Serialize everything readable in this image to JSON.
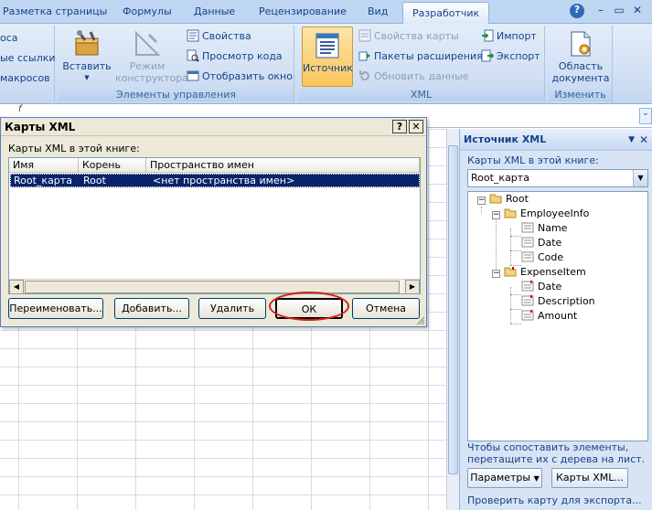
{
  "tabs": [
    "Разметка страницы",
    "Формулы",
    "Данные",
    "Рецензирование",
    "Вид",
    "Разработчик"
  ],
  "active_tab": "Разработчик",
  "window_controls": [
    "?",
    "–",
    "▭",
    "✕"
  ],
  "ribbon": {
    "code_group": {
      "visible_items": [
        "оса",
        "ые ссылки",
        "макросов"
      ]
    },
    "controls_group": {
      "label": "Элементы управления",
      "insert": "Вставить",
      "design_mode_line1": "Режим",
      "design_mode_line2": "конструктора",
      "properties": "Свойства",
      "view_code": "Просмотр кода",
      "show_window": "Отобразить окно"
    },
    "xml_group": {
      "label": "XML",
      "source": "Источник",
      "map_properties": "Свойства карты",
      "expansion_packs": "Пакеты расширения",
      "refresh_data": "Обновить данные",
      "import": "Импорт",
      "export": "Экспорт"
    },
    "modify_group": {
      "label": "Изменить",
      "doc_area_line1": "Область",
      "doc_area_line2": "документа"
    }
  },
  "formula_bar": {
    "fragment": "f"
  },
  "dialog": {
    "title": "Карты XML",
    "help": "?",
    "close": "✕",
    "maps_label": "Карты XML в этой книге:",
    "columns": [
      "Имя",
      "Корень",
      "Пространство имен"
    ],
    "rows": [
      {
        "name": "Root_карта",
        "root": "Root",
        "namespace": "<нет пространства имен>"
      }
    ],
    "buttons": {
      "rename": "Переименовать...",
      "add": "Добавить...",
      "delete": "Удалить",
      "ok": "ОК",
      "cancel": "Отмена"
    }
  },
  "xml_pane": {
    "title": "Источник XML",
    "maps_label": "Карты XML в этой книге:",
    "selected_map": "Root_карта",
    "tree": {
      "root": "Root",
      "employee": "EmployeeInfo",
      "employee_children": [
        "Name",
        "Date",
        "Code"
      ],
      "expense": "ExpenseItem",
      "expense_children": [
        "Date",
        "Description",
        "Amount"
      ]
    },
    "hint": "Чтобы сопоставить элементы, перетащите их с дерева на лист.",
    "options_button": "Параметры",
    "maps_button": "Карты XML...",
    "verify_link": "Проверить карту для экспорта..."
  }
}
